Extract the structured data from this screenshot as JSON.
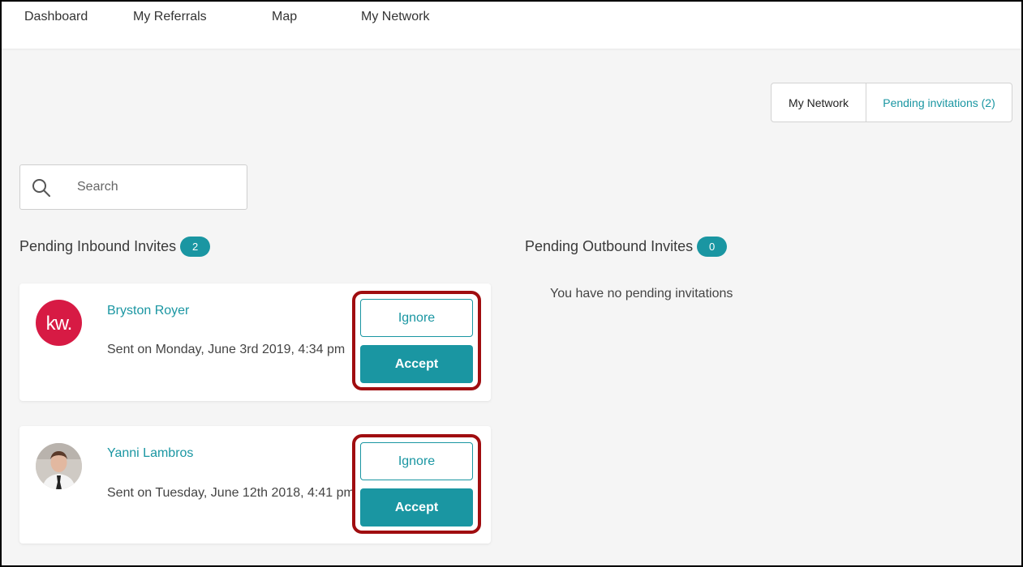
{
  "nav": {
    "items": [
      {
        "label": "Dashboard"
      },
      {
        "label": "My Referrals"
      },
      {
        "label": "Map"
      },
      {
        "label": "My Network"
      }
    ]
  },
  "view_toggle": {
    "my_network": "My Network",
    "pending": "Pending invitations (2)"
  },
  "search": {
    "placeholder": "Search",
    "icon": "search-icon"
  },
  "inbound": {
    "title": "Pending Inbound Invites",
    "count": "2",
    "invites": [
      {
        "name": "Bryston Royer",
        "avatar_text": "kw.",
        "sent": "Sent on Monday, June 3rd 2019, 4:34 pm",
        "ignore_label": "Ignore",
        "accept_label": "Accept"
      },
      {
        "name": "Yanni Lambros",
        "avatar_text": "",
        "sent": "Sent on Tuesday, June 12th 2018, 4:41 pm",
        "ignore_label": "Ignore",
        "accept_label": "Accept"
      }
    ]
  },
  "outbound": {
    "title": "Pending Outbound Invites",
    "count": "0",
    "empty_message": "You have no pending invitations"
  },
  "colors": {
    "accent": "#1a96a2",
    "highlight": "#a00d10",
    "kw_red": "#d71a44"
  }
}
